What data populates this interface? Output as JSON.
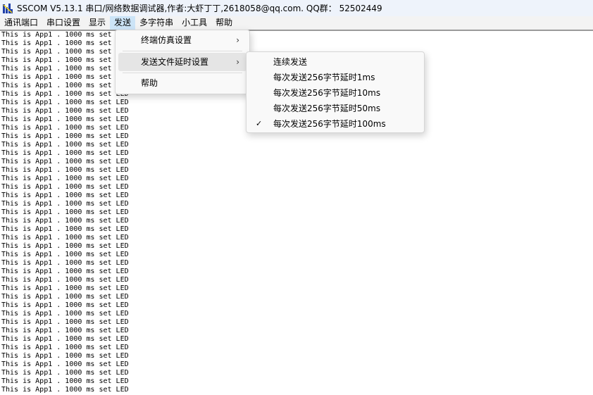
{
  "window": {
    "title": "SSCOM V5.13.1 串口/网络数据调试器,作者:大虾丁丁,2618058@qq.com. QQ群：  52502449",
    "icon": "sscom-app-icon"
  },
  "menubar": {
    "items": [
      {
        "label": "通讯端口"
      },
      {
        "label": "串口设置"
      },
      {
        "label": "显示"
      },
      {
        "label": "发送"
      },
      {
        "label": "多字符串"
      },
      {
        "label": "小工具"
      },
      {
        "label": "帮助"
      }
    ]
  },
  "send_menu": {
    "items": [
      {
        "label": "终端仿真设置",
        "submenu": true
      },
      {
        "label": "发送文件延时设置",
        "submenu": true
      },
      {
        "label": "帮助",
        "submenu": false
      }
    ],
    "submenu_icon": "chevron-right-icon"
  },
  "delay_submenu": {
    "items": [
      {
        "label": "连续发送",
        "checked": false
      },
      {
        "label": "每次发送256字节延时1ms",
        "checked": false
      },
      {
        "label": "每次发送256字节延时10ms",
        "checked": false
      },
      {
        "label": "每次发送256字节延时50ms",
        "checked": false
      },
      {
        "label": "每次发送256字节延时100ms",
        "checked": true
      }
    ],
    "check_icon": "checkmark-icon"
  },
  "terminal": {
    "line_text": "This is App1 . 1000 ms set LED",
    "line_count": 43
  },
  "colors": {
    "titlebar_bg": "#eef3fb",
    "menubar_bg": "#f3f3f3",
    "menu_highlight": "#cce4f7"
  }
}
